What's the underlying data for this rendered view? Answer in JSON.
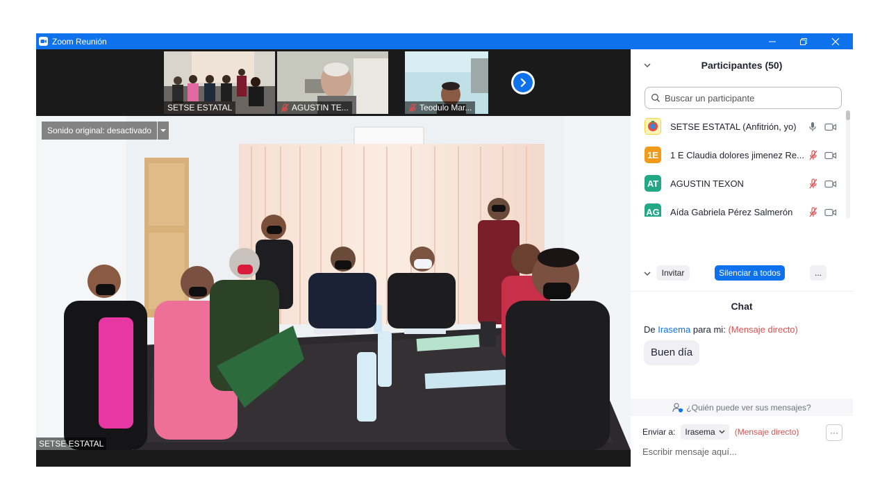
{
  "window": {
    "title": "Zoom Reunión",
    "accent": "#0e72ed"
  },
  "gallery": {
    "thumbnails": [
      {
        "name": "SETSE ESTATAL",
        "muted": false,
        "active": true
      },
      {
        "name": "AGUSTIN TE...",
        "muted": true,
        "active": false
      },
      {
        "name": "Teodulo Mar...",
        "muted": true,
        "active": false
      }
    ],
    "next_icon": "chevron-right-icon"
  },
  "main_video": {
    "sound_label": "Sonido original: desactivado",
    "speaker_name": "SETSE ESTATAL"
  },
  "participants": {
    "title": "Participantes (50)",
    "search_placeholder": "Buscar un participante",
    "list": [
      {
        "name": "SETSE ESTATAL (Anfitrión, yo)",
        "initials": "",
        "avatar_color": "#f5d33a",
        "mic": "on"
      },
      {
        "name": "1 E Claudia dolores jimenez Re...",
        "initials": "1E",
        "avatar_color": "#f29b1a",
        "mic": "muted"
      },
      {
        "name": "AGUSTIN TEXON",
        "initials": "AT",
        "avatar_color": "#22a886",
        "mic": "muted"
      },
      {
        "name": "Aída Gabriela Pérez Salmerón",
        "initials": "AG",
        "avatar_color": "#22a886",
        "mic": "muted"
      }
    ],
    "invite_label": "Invitar",
    "mute_all_label": "Silenciar a todos",
    "more_label": "..."
  },
  "chat": {
    "title": "Chat",
    "message": {
      "prefix": "De",
      "from": "Irasema",
      "to": "para mi:",
      "type": "(Mensaje directo)",
      "text": "Buen día"
    },
    "who_can_see": "¿Quién puede ver sus mensajes?",
    "send_to_label": "Enviar a:",
    "send_to_value": "Irasema",
    "send_to_type": "(Mensaje directo)",
    "more_label": "···",
    "input_placeholder": "Escribir mensaje aquí..."
  }
}
